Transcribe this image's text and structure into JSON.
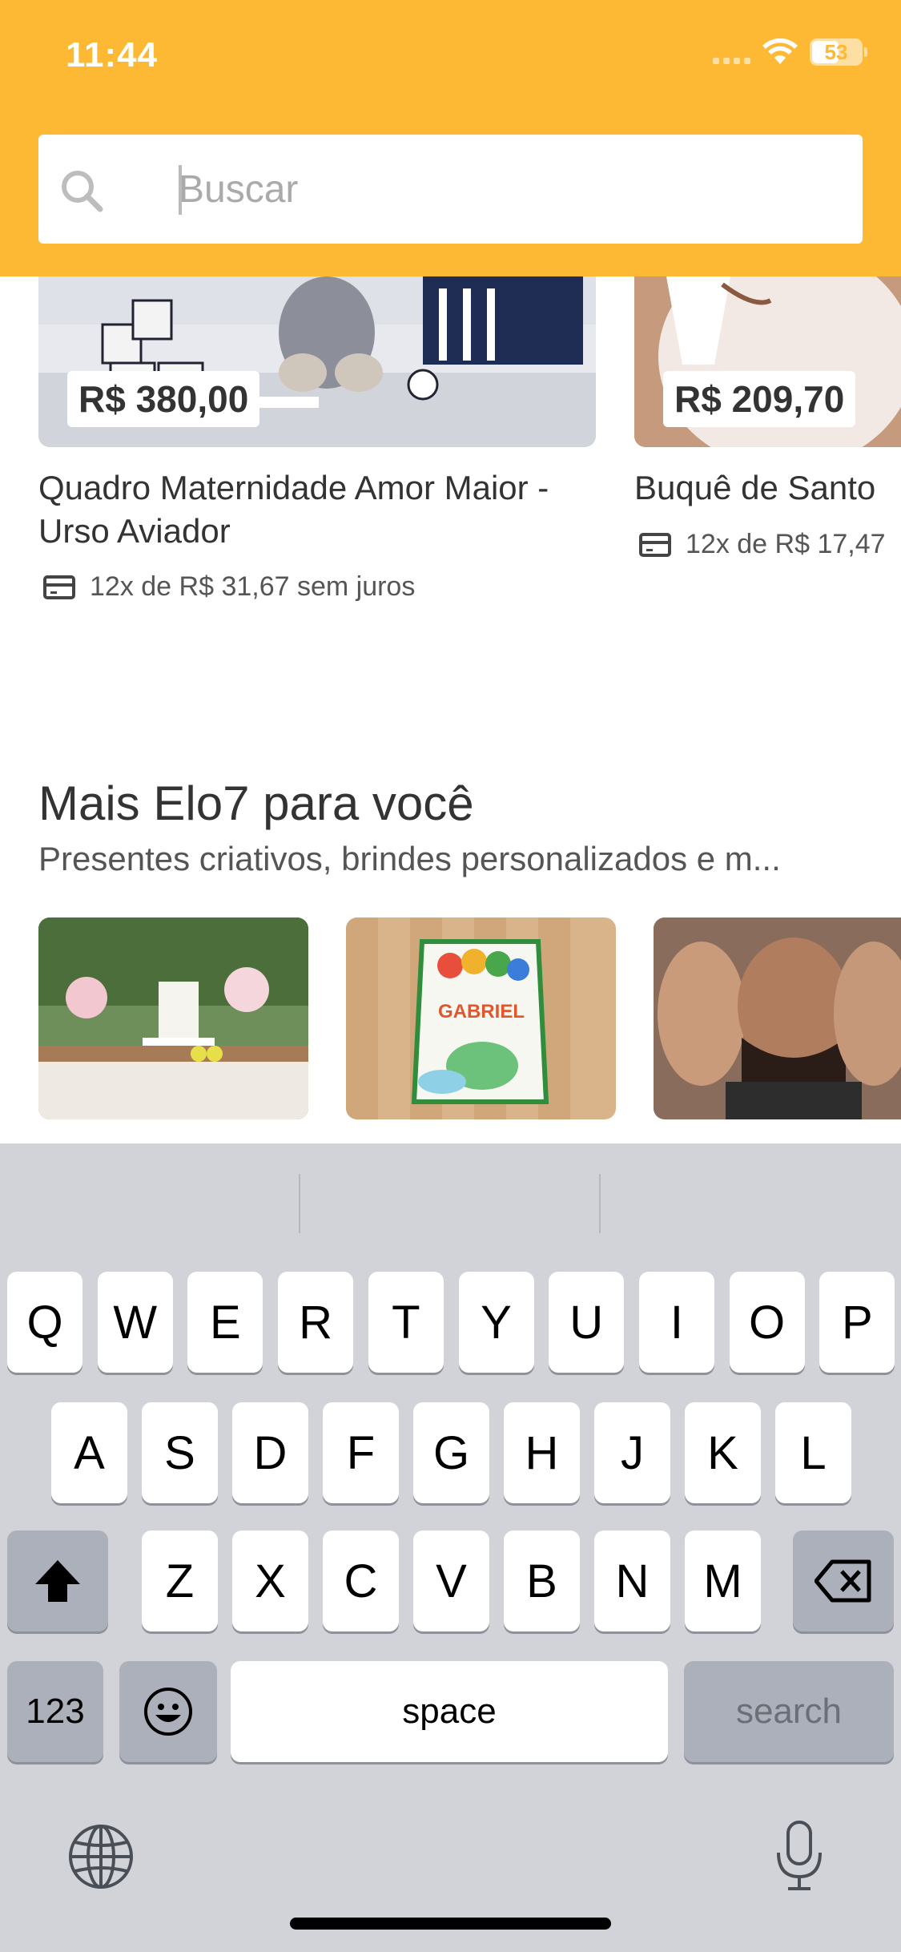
{
  "status": {
    "time": "11:44",
    "battery": "53"
  },
  "search": {
    "placeholder": "Buscar"
  },
  "products": [
    {
      "price": "R$ 380,00",
      "title": "Quadro Maternidade Amor Maior - Urso Aviador",
      "installments": "12x de R$ 31,67 sem juros"
    },
    {
      "price": "R$ 209,70",
      "title": "Buquê de Santo",
      "installments": "12x de R$ 17,47"
    }
  ],
  "section": {
    "title": "Mais Elo7 para você",
    "subtitle": "Presentes criativos, brindes personalizados e m..."
  },
  "thumbnails": [
    {
      "name": "festa-decoracao"
    },
    {
      "name": "mochila-gabriel",
      "text": "GABRIEL"
    },
    {
      "name": "dia-dos-pais"
    }
  ],
  "keyboard": {
    "row1": [
      "Q",
      "W",
      "E",
      "R",
      "T",
      "Y",
      "U",
      "I",
      "O",
      "P"
    ],
    "row2": [
      "A",
      "S",
      "D",
      "F",
      "G",
      "H",
      "J",
      "K",
      "L"
    ],
    "row3": [
      "Z",
      "X",
      "C",
      "V",
      "B",
      "N",
      "M"
    ],
    "numbers_label": "123",
    "space_label": "space",
    "search_label": "search"
  }
}
